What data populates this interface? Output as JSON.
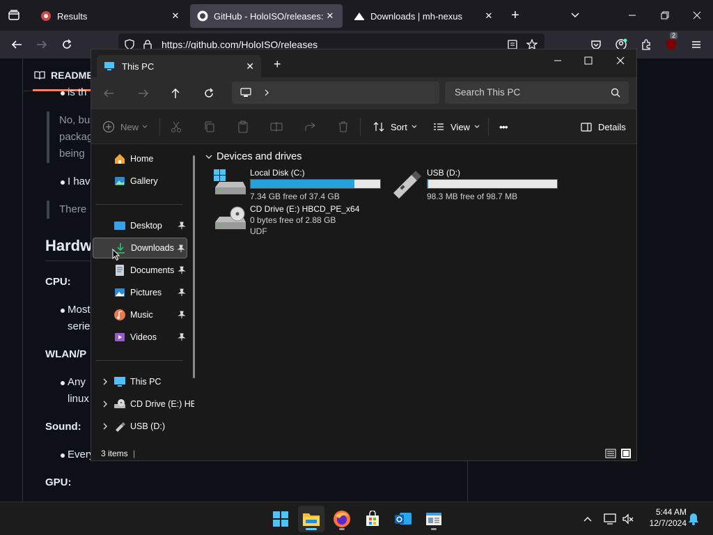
{
  "browser": {
    "tabs": [
      {
        "title": "Results"
      },
      {
        "title": "GitHub - HoloISO/releases: To r"
      },
      {
        "title": "Downloads | mh-nexus"
      }
    ],
    "url": "https://github.com/HoloISO/releases",
    "extension_badge": "2"
  },
  "github": {
    "readme_tab": "README",
    "lines": [
      "is th",
      "No, bu",
      "packag",
      "being",
      "I hav",
      "There",
      "Hardw",
      "CPU:",
      "Most",
      "serie",
      "WLAN/P",
      "Any",
      "linux",
      "Sound:",
      "Every",
      "GPU:"
    ]
  },
  "explorer": {
    "tab_title": "This PC",
    "search_placeholder": "Search This PC",
    "toolbar": {
      "new": "New",
      "sort": "Sort",
      "view": "View",
      "more": "•••",
      "details": "Details"
    },
    "nav": {
      "home": "Home",
      "gallery": "Gallery",
      "desktop": "Desktop",
      "downloads": "Downloads",
      "documents": "Documents",
      "pictures": "Pictures",
      "music": "Music",
      "videos": "Videos",
      "this_pc": "This PC",
      "cd_drive": "CD Drive (E:) HB",
      "usb": "USB (D:)"
    },
    "section_title": "Devices and drives",
    "drives": [
      {
        "name": "Local Disk (C:)",
        "free": "7.34 GB free of 37.4 GB",
        "used_fraction": 0.8
      },
      {
        "name": "USB (D:)",
        "free": "98.3 MB free of 98.7 MB",
        "used_fraction": 0.004
      },
      {
        "name": "CD Drive (E:) HBCD_PE_x64",
        "free": "0 bytes free of 2.88 GB",
        "fs": "UDF"
      }
    ],
    "status": "3 items"
  },
  "taskbar": {
    "time": "5:44 AM",
    "date": "12/7/2024"
  },
  "colors": {
    "accent": "#26a0da",
    "firefox_bg": "#1c1b22",
    "explorer_bg": "#191919"
  }
}
